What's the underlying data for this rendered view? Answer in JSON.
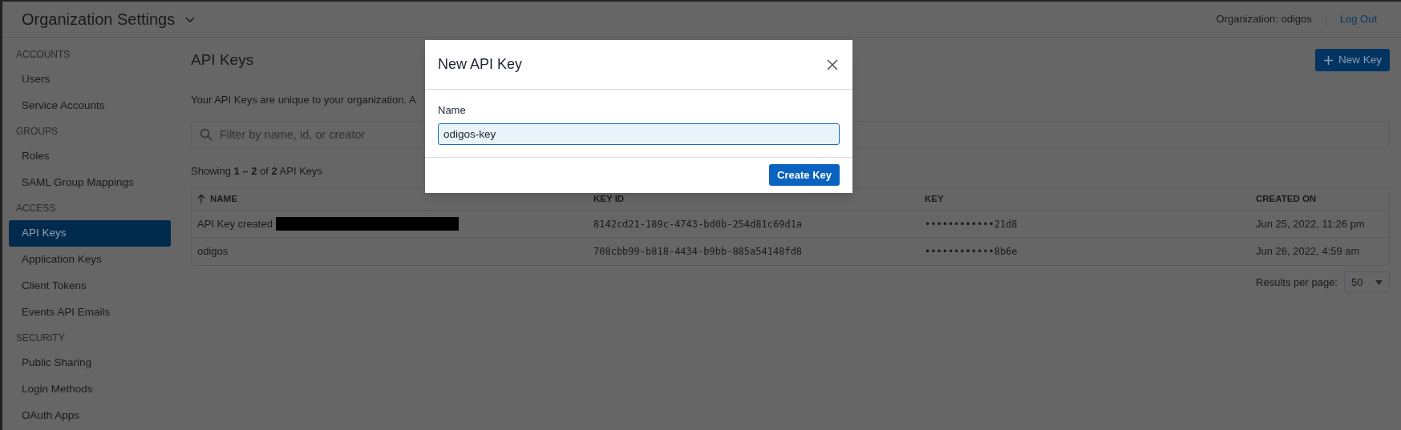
{
  "header": {
    "title": "Organization Settings",
    "org_label": "Organization: odigos",
    "logout": "Log Out"
  },
  "sidebar": {
    "sections": [
      {
        "label": "ACCOUNTS",
        "items": [
          {
            "label": "Users",
            "selected": false
          },
          {
            "label": "Service Accounts",
            "selected": false
          }
        ]
      },
      {
        "label": "GROUPS",
        "items": [
          {
            "label": "Roles",
            "selected": false
          },
          {
            "label": "SAML Group Mappings",
            "selected": false
          }
        ]
      },
      {
        "label": "ACCESS",
        "items": [
          {
            "label": "API Keys",
            "selected": true
          },
          {
            "label": "Application Keys",
            "selected": false
          },
          {
            "label": "Client Tokens",
            "selected": false
          },
          {
            "label": "Events API Emails",
            "selected": false
          }
        ]
      },
      {
        "label": "SECURITY",
        "items": [
          {
            "label": "Public Sharing",
            "selected": false
          },
          {
            "label": "Login Methods",
            "selected": false
          },
          {
            "label": "OAuth Apps",
            "selected": false
          }
        ]
      }
    ]
  },
  "main": {
    "title": "API Keys",
    "new_button": "New Key",
    "description": "Your API Keys are unique to your organization. A",
    "search": {
      "placeholder": "Filter by name, id, or creator"
    },
    "showing": "Showing **1 – 2** of **2** API Keys",
    "table": {
      "columns": [
        {
          "label": "NAME",
          "sorted": true
        },
        {
          "label": "KEY ID",
          "sorted": false
        },
        {
          "label": "KEY",
          "sorted": false
        },
        {
          "label": "CREATED ON",
          "sorted": false
        }
      ],
      "rows": [
        {
          "cells": [
            "API Key created",
            "8142cd21-189c-4743-bd0b-254d81c69d1a",
            "••••••••••••21d8",
            "Jun 25, 2022, 11:26 pm"
          ],
          "redacted": true
        },
        {
          "cells": [
            "odigos",
            "708cbb99-b818-4434-b9bb-885a54148fd8",
            "••••••••••••8b6e",
            "Jun 26, 2022, 4:59 am"
          ],
          "redacted": false
        }
      ]
    },
    "pagination": {
      "label": "Results per page:",
      "value": "50"
    }
  },
  "modal": {
    "title": "New API Key",
    "field_label": "Name",
    "field_value": "odigos-key",
    "submit": "Create Key"
  }
}
